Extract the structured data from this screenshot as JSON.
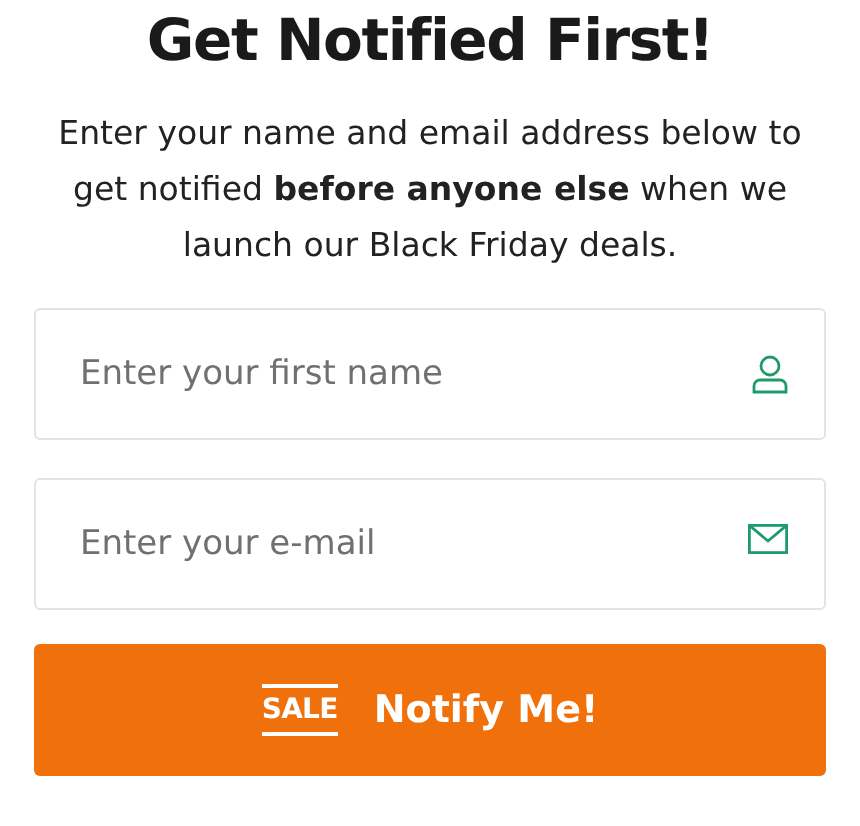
{
  "title": "Get Notified First!",
  "intro": "Enter your name and email address below to get notified **before anyone else** when we launch our Black Friday deals.",
  "fields": [
    {
      "kind": "name",
      "placeholder": "Enter your first name"
    },
    {
      "kind": "email",
      "placeholder": "Enter your e-mail"
    }
  ],
  "button": {
    "badge": "SALE",
    "label": "Notify Me!"
  }
}
